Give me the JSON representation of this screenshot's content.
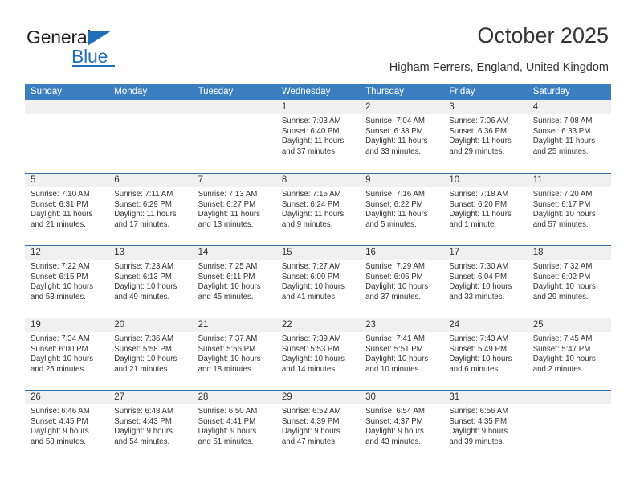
{
  "logo": {
    "word_top": "General",
    "word_bottom": "Blue",
    "accent_color": "#1f70b8"
  },
  "header": {
    "title": "October 2025",
    "subtitle": "Higham Ferrers, England, United Kingdom"
  },
  "calendar": {
    "header_background": "#3c7fc0",
    "header_text_color": "#ffffff",
    "day_band_color": "#f0f0f0",
    "row_divider_color": "#2f6da8",
    "weekdays": [
      "Sunday",
      "Monday",
      "Tuesday",
      "Wednesday",
      "Thursday",
      "Friday",
      "Saturday"
    ],
    "weeks": [
      [
        {
          "day": "",
          "sunrise": "",
          "sunset": "",
          "daylight_line1": "",
          "daylight_line2": "",
          "empty": true
        },
        {
          "day": "",
          "sunrise": "",
          "sunset": "",
          "daylight_line1": "",
          "daylight_line2": "",
          "empty": true
        },
        {
          "day": "",
          "sunrise": "",
          "sunset": "",
          "daylight_line1": "",
          "daylight_line2": "",
          "empty": true
        },
        {
          "day": "1",
          "sunrise": "Sunrise: 7:03 AM",
          "sunset": "Sunset: 6:40 PM",
          "daylight_line1": "Daylight: 11 hours",
          "daylight_line2": "and 37 minutes."
        },
        {
          "day": "2",
          "sunrise": "Sunrise: 7:04 AM",
          "sunset": "Sunset: 6:38 PM",
          "daylight_line1": "Daylight: 11 hours",
          "daylight_line2": "and 33 minutes."
        },
        {
          "day": "3",
          "sunrise": "Sunrise: 7:06 AM",
          "sunset": "Sunset: 6:36 PM",
          "daylight_line1": "Daylight: 11 hours",
          "daylight_line2": "and 29 minutes."
        },
        {
          "day": "4",
          "sunrise": "Sunrise: 7:08 AM",
          "sunset": "Sunset: 6:33 PM",
          "daylight_line1": "Daylight: 11 hours",
          "daylight_line2": "and 25 minutes."
        }
      ],
      [
        {
          "day": "5",
          "sunrise": "Sunrise: 7:10 AM",
          "sunset": "Sunset: 6:31 PM",
          "daylight_line1": "Daylight: 11 hours",
          "daylight_line2": "and 21 minutes."
        },
        {
          "day": "6",
          "sunrise": "Sunrise: 7:11 AM",
          "sunset": "Sunset: 6:29 PM",
          "daylight_line1": "Daylight: 11 hours",
          "daylight_line2": "and 17 minutes."
        },
        {
          "day": "7",
          "sunrise": "Sunrise: 7:13 AM",
          "sunset": "Sunset: 6:27 PM",
          "daylight_line1": "Daylight: 11 hours",
          "daylight_line2": "and 13 minutes."
        },
        {
          "day": "8",
          "sunrise": "Sunrise: 7:15 AM",
          "sunset": "Sunset: 6:24 PM",
          "daylight_line1": "Daylight: 11 hours",
          "daylight_line2": "and 9 minutes."
        },
        {
          "day": "9",
          "sunrise": "Sunrise: 7:16 AM",
          "sunset": "Sunset: 6:22 PM",
          "daylight_line1": "Daylight: 11 hours",
          "daylight_line2": "and 5 minutes."
        },
        {
          "day": "10",
          "sunrise": "Sunrise: 7:18 AM",
          "sunset": "Sunset: 6:20 PM",
          "daylight_line1": "Daylight: 11 hours",
          "daylight_line2": "and 1 minute."
        },
        {
          "day": "11",
          "sunrise": "Sunrise: 7:20 AM",
          "sunset": "Sunset: 6:17 PM",
          "daylight_line1": "Daylight: 10 hours",
          "daylight_line2": "and 57 minutes."
        }
      ],
      [
        {
          "day": "12",
          "sunrise": "Sunrise: 7:22 AM",
          "sunset": "Sunset: 6:15 PM",
          "daylight_line1": "Daylight: 10 hours",
          "daylight_line2": "and 53 minutes."
        },
        {
          "day": "13",
          "sunrise": "Sunrise: 7:23 AM",
          "sunset": "Sunset: 6:13 PM",
          "daylight_line1": "Daylight: 10 hours",
          "daylight_line2": "and 49 minutes."
        },
        {
          "day": "14",
          "sunrise": "Sunrise: 7:25 AM",
          "sunset": "Sunset: 6:11 PM",
          "daylight_line1": "Daylight: 10 hours",
          "daylight_line2": "and 45 minutes."
        },
        {
          "day": "15",
          "sunrise": "Sunrise: 7:27 AM",
          "sunset": "Sunset: 6:09 PM",
          "daylight_line1": "Daylight: 10 hours",
          "daylight_line2": "and 41 minutes."
        },
        {
          "day": "16",
          "sunrise": "Sunrise: 7:29 AM",
          "sunset": "Sunset: 6:06 PM",
          "daylight_line1": "Daylight: 10 hours",
          "daylight_line2": "and 37 minutes."
        },
        {
          "day": "17",
          "sunrise": "Sunrise: 7:30 AM",
          "sunset": "Sunset: 6:04 PM",
          "daylight_line1": "Daylight: 10 hours",
          "daylight_line2": "and 33 minutes."
        },
        {
          "day": "18",
          "sunrise": "Sunrise: 7:32 AM",
          "sunset": "Sunset: 6:02 PM",
          "daylight_line1": "Daylight: 10 hours",
          "daylight_line2": "and 29 minutes."
        }
      ],
      [
        {
          "day": "19",
          "sunrise": "Sunrise: 7:34 AM",
          "sunset": "Sunset: 6:00 PM",
          "daylight_line1": "Daylight: 10 hours",
          "daylight_line2": "and 25 minutes."
        },
        {
          "day": "20",
          "sunrise": "Sunrise: 7:36 AM",
          "sunset": "Sunset: 5:58 PM",
          "daylight_line1": "Daylight: 10 hours",
          "daylight_line2": "and 21 minutes."
        },
        {
          "day": "21",
          "sunrise": "Sunrise: 7:37 AM",
          "sunset": "Sunset: 5:56 PM",
          "daylight_line1": "Daylight: 10 hours",
          "daylight_line2": "and 18 minutes."
        },
        {
          "day": "22",
          "sunrise": "Sunrise: 7:39 AM",
          "sunset": "Sunset: 5:53 PM",
          "daylight_line1": "Daylight: 10 hours",
          "daylight_line2": "and 14 minutes."
        },
        {
          "day": "23",
          "sunrise": "Sunrise: 7:41 AM",
          "sunset": "Sunset: 5:51 PM",
          "daylight_line1": "Daylight: 10 hours",
          "daylight_line2": "and 10 minutes."
        },
        {
          "day": "24",
          "sunrise": "Sunrise: 7:43 AM",
          "sunset": "Sunset: 5:49 PM",
          "daylight_line1": "Daylight: 10 hours",
          "daylight_line2": "and 6 minutes."
        },
        {
          "day": "25",
          "sunrise": "Sunrise: 7:45 AM",
          "sunset": "Sunset: 5:47 PM",
          "daylight_line1": "Daylight: 10 hours",
          "daylight_line2": "and 2 minutes."
        }
      ],
      [
        {
          "day": "26",
          "sunrise": "Sunrise: 6:46 AM",
          "sunset": "Sunset: 4:45 PM",
          "daylight_line1": "Daylight: 9 hours",
          "daylight_line2": "and 58 minutes."
        },
        {
          "day": "27",
          "sunrise": "Sunrise: 6:48 AM",
          "sunset": "Sunset: 4:43 PM",
          "daylight_line1": "Daylight: 9 hours",
          "daylight_line2": "and 54 minutes."
        },
        {
          "day": "28",
          "sunrise": "Sunrise: 6:50 AM",
          "sunset": "Sunset: 4:41 PM",
          "daylight_line1": "Daylight: 9 hours",
          "daylight_line2": "and 51 minutes."
        },
        {
          "day": "29",
          "sunrise": "Sunrise: 6:52 AM",
          "sunset": "Sunset: 4:39 PM",
          "daylight_line1": "Daylight: 9 hours",
          "daylight_line2": "and 47 minutes."
        },
        {
          "day": "30",
          "sunrise": "Sunrise: 6:54 AM",
          "sunset": "Sunset: 4:37 PM",
          "daylight_line1": "Daylight: 9 hours",
          "daylight_line2": "and 43 minutes."
        },
        {
          "day": "31",
          "sunrise": "Sunrise: 6:56 AM",
          "sunset": "Sunset: 4:35 PM",
          "daylight_line1": "Daylight: 9 hours",
          "daylight_line2": "and 39 minutes."
        },
        {
          "day": "",
          "sunrise": "",
          "sunset": "",
          "daylight_line1": "",
          "daylight_line2": "",
          "empty": true
        }
      ]
    ]
  }
}
